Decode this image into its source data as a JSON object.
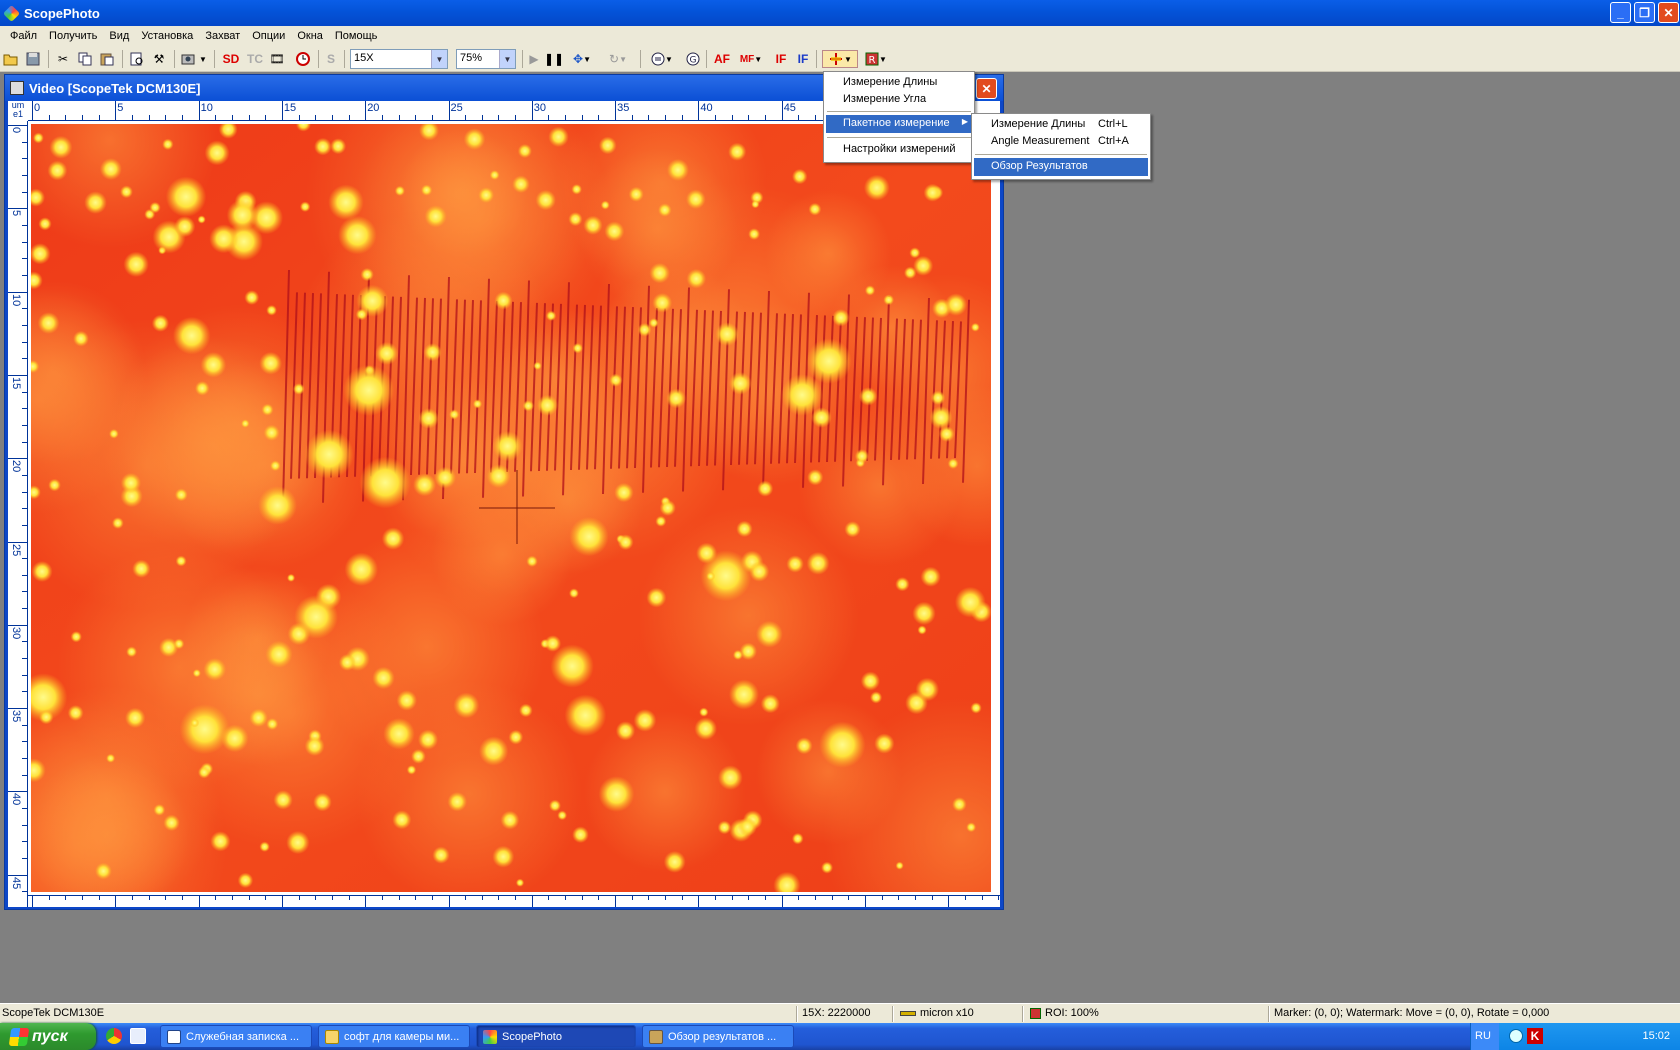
{
  "app": {
    "title": "ScopePhoto"
  },
  "menu": [
    "Файл",
    "Получить",
    "Вид",
    "Установка",
    "Захват",
    "Опции",
    "Окна",
    "Помощь"
  ],
  "toolbar": {
    "zoom_value": "15X",
    "percent_value": "75%",
    "sd_label": "SD",
    "tc_label": "TC",
    "s_label": "S",
    "af_label": "AF",
    "mf_label": "MF",
    "if1_label": "IF",
    "if2_label": "IF"
  },
  "video_window": {
    "title": "Video [ScopeTek DCM130E]",
    "ruler_unit": "um\ne1",
    "h_ticks": [
      "0",
      "5",
      "10",
      "15",
      "20",
      "25",
      "30",
      "35",
      "40",
      "45"
    ],
    "v_ticks": [
      "0",
      "5",
      "10",
      "15",
      "20",
      "25",
      "30",
      "35",
      "40",
      "45"
    ]
  },
  "measure_menu": {
    "item1": "Измерение Длины",
    "item2": "Измерение Угла",
    "item3": "Пакетное измерение",
    "item4": "Настройки измерений"
  },
  "batch_submenu": {
    "item1": "Измерение Длины",
    "item1_key": "Ctrl+L",
    "item2": "Angle Measurement",
    "item2_key": "Ctrl+A",
    "item3": "Обзор Результатов"
  },
  "status": {
    "device": "ScopeTek DCM130E",
    "magnification": "15X: 2220000",
    "scale": "micron x10",
    "roi": "ROI: 100%",
    "marker": "Marker: (0, 0); Watermark: Move = (0, 0), Rotate = 0,000"
  },
  "taskbar": {
    "start_label": "пуск",
    "tasks": [
      "Служебная записка ...",
      "софт для камеры ми...",
      "ScopePhoto",
      "Обзор результатов ..."
    ],
    "lang": "RU",
    "clock": "15:02"
  }
}
